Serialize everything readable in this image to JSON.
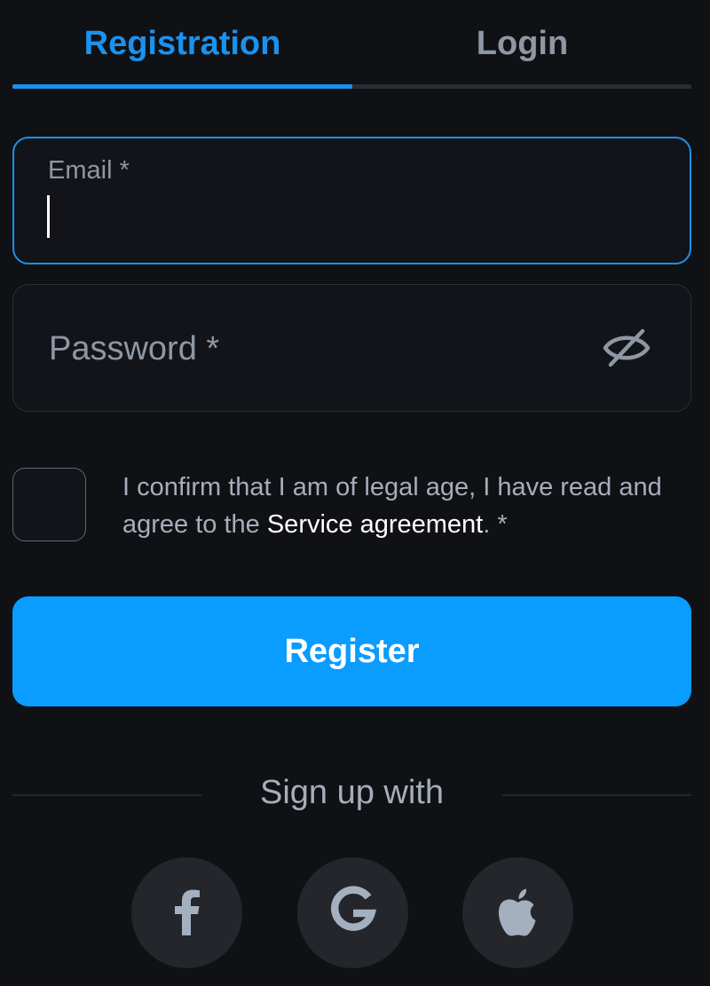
{
  "tabs": {
    "registration": "Registration",
    "login": "Login"
  },
  "form": {
    "email_label": "Email *",
    "email_value": "",
    "password_placeholder": "Password *",
    "password_value": "",
    "consent_text": "I confirm that I am of legal age, I have read and agree to the ",
    "consent_link": "Service agreement",
    "consent_suffix": ". *",
    "checkbox_checked": false,
    "register_label": "Register"
  },
  "social": {
    "title": "Sign up with",
    "providers": [
      {
        "name": "facebook",
        "icon": "facebook-icon"
      },
      {
        "name": "google",
        "icon": "google-icon"
      },
      {
        "name": "apple",
        "icon": "apple-icon"
      }
    ]
  },
  "colors": {
    "background": "#101115",
    "accent": "#1a92ee",
    "button": "#0b9cff",
    "muted_text": "#8e97a3",
    "social_bg": "#24262b",
    "social_icon": "#a4b0bf"
  }
}
